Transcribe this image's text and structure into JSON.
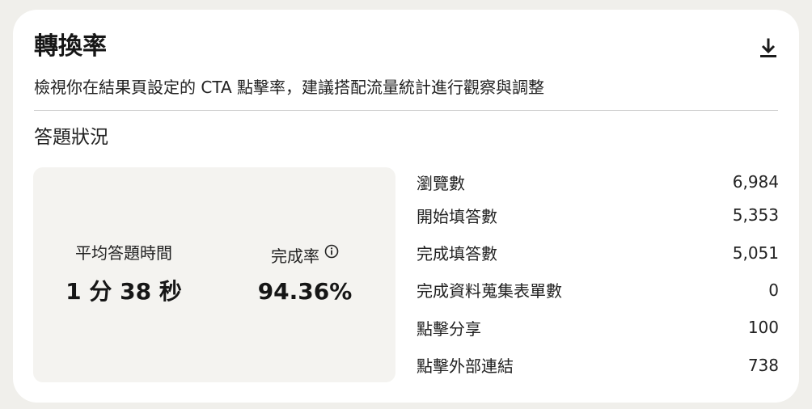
{
  "card": {
    "title": "轉換率",
    "subtitle": "檢視你在結果頁設定的 CTA 點擊率，建議搭配流量統計進行觀察與調整",
    "download_icon": "download-icon"
  },
  "section": {
    "title": "答題狀況"
  },
  "summary": {
    "avg_time_label": "平均答題時間",
    "avg_time_value": "1 分 38 秒",
    "completion_label": "完成率",
    "completion_value": "94.36%",
    "info_icon": "info-icon"
  },
  "stats": [
    {
      "label": "瀏覽數",
      "value": "6,984"
    },
    {
      "label": "開始填答數",
      "value": "5,353"
    },
    {
      "label": "完成填答數",
      "value": "5,051"
    },
    {
      "label": "完成資料蒐集表單數",
      "value": "0"
    },
    {
      "label": "點擊分享",
      "value": "100"
    },
    {
      "label": "點擊外部連結",
      "value": "738"
    }
  ]
}
